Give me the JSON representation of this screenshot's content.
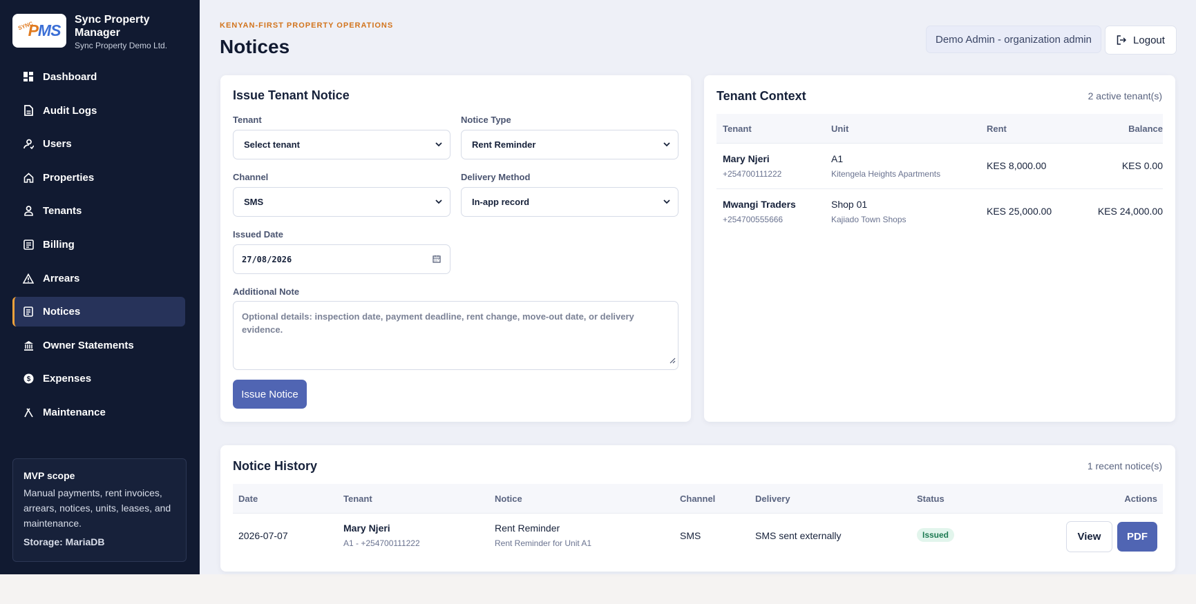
{
  "brand": {
    "name": "Sync Property Manager",
    "org": "Sync Property Demo Ltd.",
    "logo_sync": "SYNC",
    "logo_p": "P",
    "logo_ms": "MS"
  },
  "nav": [
    {
      "label": "Dashboard",
      "icon": "dashboard-icon"
    },
    {
      "label": "Audit Logs",
      "icon": "document-icon"
    },
    {
      "label": "Users",
      "icon": "users-icon"
    },
    {
      "label": "Properties",
      "icon": "home-icon"
    },
    {
      "label": "Tenants",
      "icon": "tenant-icon"
    },
    {
      "label": "Billing",
      "icon": "billing-icon"
    },
    {
      "label": "Arrears",
      "icon": "warning-icon"
    },
    {
      "label": "Notices",
      "icon": "notice-icon",
      "active": true
    },
    {
      "label": "Owner Statements",
      "icon": "bank-icon"
    },
    {
      "label": "Expenses",
      "icon": "dollar-icon"
    },
    {
      "label": "Maintenance",
      "icon": "tools-icon"
    }
  ],
  "scope": {
    "title": "MVP scope",
    "text": "Manual payments, rent invoices, arrears, notices, units, leases, and maintenance.",
    "storage": "Storage: MariaDB"
  },
  "header": {
    "eyebrow": "KENYAN-FIRST PROPERTY OPERATIONS",
    "title": "Notices",
    "user": "Demo Admin - organization admin",
    "logout": "Logout"
  },
  "form": {
    "title": "Issue Tenant Notice",
    "tenant_label": "Tenant",
    "tenant_value": "Select tenant",
    "notice_type_label": "Notice Type",
    "notice_type_value": "Rent Reminder",
    "channel_label": "Channel",
    "channel_value": "SMS",
    "delivery_label": "Delivery Method",
    "delivery_value": "In-app record",
    "date_label": "Issued Date",
    "date_value": "27/08/2026",
    "note_label": "Additional Note",
    "note_placeholder": "Optional details: inspection date, payment deadline, rent change, move-out date, or delivery evidence.",
    "submit": "Issue Notice"
  },
  "context": {
    "title": "Tenant Context",
    "count": "2 active tenant(s)",
    "headers": {
      "tenant": "Tenant",
      "unit": "Unit",
      "rent": "Rent",
      "balance": "Balance"
    },
    "rows": [
      {
        "name": "Mary Njeri",
        "phone": "+254700111222",
        "unit": "A1",
        "property": "Kitengela Heights Apartments",
        "rent": "KES 8,000.00",
        "balance": "KES 0.00"
      },
      {
        "name": "Mwangi Traders",
        "phone": "+254700555666",
        "unit": "Shop 01",
        "property": "Kajiado Town Shops",
        "rent": "KES 25,000.00",
        "balance": "KES 24,000.00"
      }
    ]
  },
  "history": {
    "title": "Notice History",
    "count": "1 recent notice(s)",
    "headers": {
      "date": "Date",
      "tenant": "Tenant",
      "notice": "Notice",
      "channel": "Channel",
      "delivery": "Delivery",
      "status": "Status",
      "actions": "Actions"
    },
    "rows": [
      {
        "date": "2026-07-07",
        "tenant": "Mary Njeri",
        "tenant_sub": "A1 - +254700111222",
        "notice": "Rent Reminder",
        "notice_sub": "Rent Reminder for Unit A1",
        "channel": "SMS",
        "delivery": "SMS sent externally",
        "status": "Issued",
        "view": "View",
        "pdf": "PDF"
      }
    ]
  },
  "colors": {
    "sidebar": "#111a31",
    "accent": "#5065b3",
    "eyebrow": "#d2741d",
    "active_border": "#f0a23b"
  }
}
